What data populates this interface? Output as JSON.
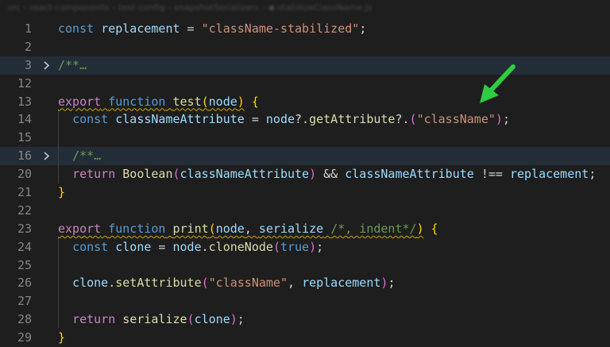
{
  "breadcrumb": {
    "text": "src › react-components › test-config › snapshotSerializers › ◆ stabilizeClassName.js"
  },
  "lines": [
    {
      "num": "1",
      "folded": false,
      "fold": false,
      "indent": 0,
      "tokens": [
        [
          "kw",
          "const"
        ],
        [
          "t",
          " "
        ],
        [
          "var",
          "replacement"
        ],
        [
          "t",
          " = "
        ],
        [
          "str",
          "\"className-stabilized\""
        ],
        [
          "t",
          ";"
        ]
      ]
    },
    {
      "num": "2",
      "folded": false,
      "fold": false,
      "indent": 0,
      "tokens": []
    },
    {
      "num": "3",
      "folded": true,
      "fold": true,
      "indent": 0,
      "tokens": [
        [
          "cmt",
          "/**"
        ],
        [
          "ellipsis",
          "…"
        ]
      ]
    },
    {
      "num": "12",
      "folded": false,
      "fold": false,
      "indent": 0,
      "tokens": []
    },
    {
      "num": "13",
      "folded": false,
      "fold": false,
      "indent": 0,
      "tokens": [
        [
          "kw2",
          "export"
        ],
        [
          "t",
          " "
        ],
        [
          "kw",
          "function"
        ],
        [
          "t",
          " "
        ],
        [
          "fn",
          "test"
        ],
        [
          "br1",
          "("
        ],
        [
          "var",
          "node"
        ],
        [
          "br1",
          ")"
        ],
        [
          "t",
          " "
        ],
        [
          "br1",
          "{"
        ]
      ],
      "squiggle": true
    },
    {
      "num": "14",
      "folded": false,
      "fold": false,
      "indent": 1,
      "tokens": [
        [
          "t",
          "  "
        ],
        [
          "kw",
          "const"
        ],
        [
          "t",
          " "
        ],
        [
          "var",
          "classNameAttribute"
        ],
        [
          "t",
          " = "
        ],
        [
          "var",
          "node"
        ],
        [
          "t",
          "?."
        ],
        [
          "fn",
          "getAttribute"
        ],
        [
          "t",
          "?."
        ],
        [
          "br2",
          "("
        ],
        [
          "str",
          "\"className\""
        ],
        [
          "br2",
          ")"
        ],
        [
          "t",
          ";"
        ]
      ]
    },
    {
      "num": "15",
      "folded": false,
      "fold": false,
      "indent": 1,
      "tokens": []
    },
    {
      "num": "16",
      "folded": true,
      "fold": true,
      "indent": 1,
      "tokens": [
        [
          "t",
          "  "
        ],
        [
          "cmt",
          "/**"
        ],
        [
          "ellipsis",
          "…"
        ]
      ]
    },
    {
      "num": "20",
      "folded": false,
      "fold": false,
      "indent": 1,
      "tokens": [
        [
          "t",
          "  "
        ],
        [
          "kw2",
          "return"
        ],
        [
          "t",
          " "
        ],
        [
          "fn",
          "Boolean"
        ],
        [
          "br2",
          "("
        ],
        [
          "var",
          "classNameAttribute"
        ],
        [
          "br2",
          ")"
        ],
        [
          "t",
          " && "
        ],
        [
          "var",
          "classNameAttribute"
        ],
        [
          "t",
          " !== "
        ],
        [
          "var",
          "replacement"
        ],
        [
          "t",
          ";"
        ]
      ]
    },
    {
      "num": "21",
      "folded": false,
      "fold": false,
      "indent": 0,
      "tokens": [
        [
          "br1",
          "}"
        ]
      ]
    },
    {
      "num": "22",
      "folded": false,
      "fold": false,
      "indent": 0,
      "tokens": []
    },
    {
      "num": "23",
      "folded": false,
      "fold": false,
      "indent": 0,
      "tokens": [
        [
          "kw2",
          "export"
        ],
        [
          "t",
          " "
        ],
        [
          "kw",
          "function"
        ],
        [
          "t",
          " "
        ],
        [
          "fn",
          "print"
        ],
        [
          "br1",
          "("
        ],
        [
          "var",
          "node"
        ],
        [
          "t",
          ", "
        ],
        [
          "var",
          "serialize"
        ],
        [
          "t",
          " "
        ],
        [
          "cmt",
          "/*, indent*/"
        ],
        [
          "br1",
          ")"
        ],
        [
          "t",
          " "
        ],
        [
          "br1",
          "{"
        ]
      ],
      "squiggle": true
    },
    {
      "num": "24",
      "folded": false,
      "fold": false,
      "indent": 1,
      "tokens": [
        [
          "t",
          "  "
        ],
        [
          "kw",
          "const"
        ],
        [
          "t",
          " "
        ],
        [
          "var",
          "clone"
        ],
        [
          "t",
          " = "
        ],
        [
          "var",
          "node"
        ],
        [
          "t",
          "."
        ],
        [
          "fn",
          "cloneNode"
        ],
        [
          "br2",
          "("
        ],
        [
          "kw",
          "true"
        ],
        [
          "br2",
          ")"
        ],
        [
          "t",
          ";"
        ]
      ]
    },
    {
      "num": "25",
      "folded": false,
      "fold": false,
      "indent": 1,
      "tokens": []
    },
    {
      "num": "26",
      "folded": false,
      "fold": false,
      "indent": 1,
      "tokens": [
        [
          "t",
          "  "
        ],
        [
          "var",
          "clone"
        ],
        [
          "t",
          "."
        ],
        [
          "fn",
          "setAttribute"
        ],
        [
          "br2",
          "("
        ],
        [
          "str",
          "\"className\""
        ],
        [
          "t",
          ", "
        ],
        [
          "var",
          "replacement"
        ],
        [
          "br2",
          ")"
        ],
        [
          "t",
          ";"
        ]
      ]
    },
    {
      "num": "27",
      "folded": false,
      "fold": false,
      "indent": 1,
      "tokens": []
    },
    {
      "num": "28",
      "folded": false,
      "fold": false,
      "indent": 1,
      "tokens": [
        [
          "t",
          "  "
        ],
        [
          "kw2",
          "return"
        ],
        [
          "t",
          " "
        ],
        [
          "fn",
          "serialize"
        ],
        [
          "br2",
          "("
        ],
        [
          "var",
          "clone"
        ],
        [
          "br2",
          ")"
        ],
        [
          "t",
          ";"
        ]
      ]
    },
    {
      "num": "29",
      "folded": false,
      "fold": false,
      "indent": 0,
      "tokens": [
        [
          "br1",
          "}"
        ]
      ]
    }
  ],
  "colors": {
    "background": "#1e1e1e",
    "folded_line_bg": "#232d38",
    "annotation_arrow": "#2ecc40"
  },
  "annotation": {
    "icon": "green-arrow-icon",
    "points_to": "\"className\""
  }
}
